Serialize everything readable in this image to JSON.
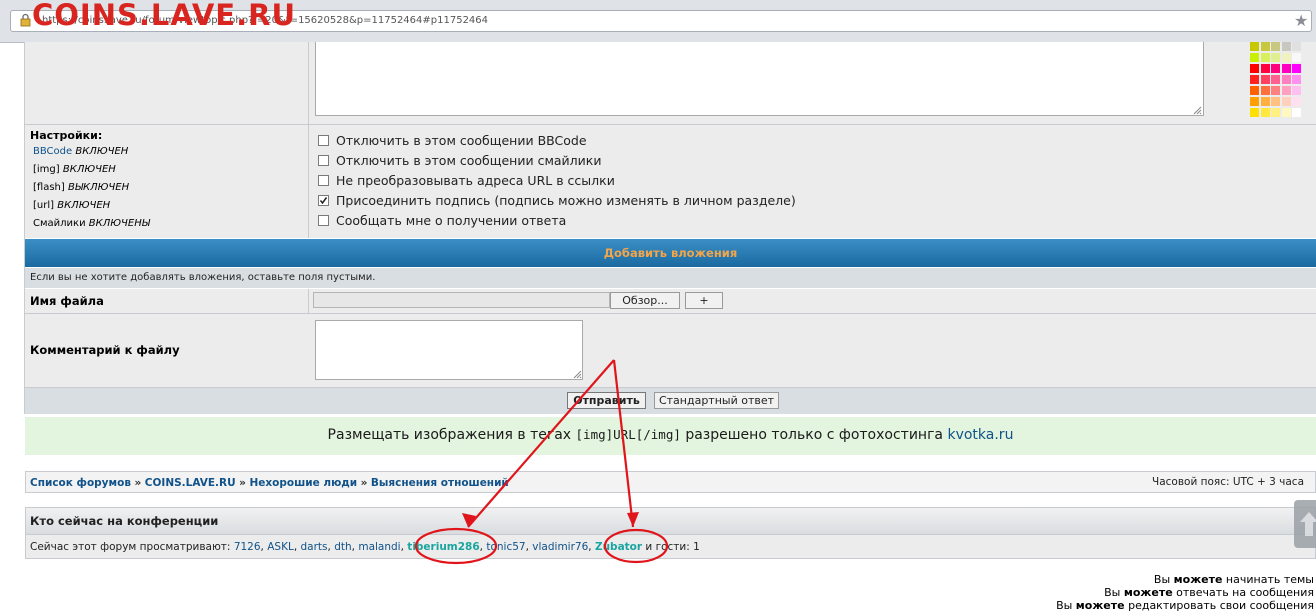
{
  "watermark": "COINS.LAVE.RU",
  "browser": {
    "url": "https://coins.lave.ru/forum/viewtopic.php?f=20&t=15620528&p=11752464#p11752464",
    "url_visible": "https://coins.lave.ru/forum/viewtopic.php?f=20&t=15620528&p=11752464#p11752464"
  },
  "settings": {
    "title": "Настройки:",
    "lines": [
      {
        "name": "BBCode",
        "state": "ВКЛЮЧЕН"
      },
      {
        "name": "[img]",
        "state": "ВКЛЮЧЕН"
      },
      {
        "name": "[flash]",
        "state": "ВЫКЛЮЧЕН"
      },
      {
        "name": "[url]",
        "state": "ВКЛЮЧЕН"
      },
      {
        "name": "Смайлики",
        "state": "ВКЛЮЧЕНЫ"
      }
    ],
    "options": [
      {
        "label": "Отключить в этом сообщении BBCode",
        "checked": false
      },
      {
        "label": "Отключить в этом сообщении смайлики",
        "checked": false
      },
      {
        "label": "Не преобразовывать адреса URL в ссылки",
        "checked": false
      },
      {
        "label": "Присоединить подпись (подпись можно изменять в личном разделе)",
        "checked": true
      },
      {
        "label": "Сообщать мне о получении ответа",
        "checked": false
      }
    ]
  },
  "attachments": {
    "header": "Добавить вложения",
    "note": "Если вы не хотите добавлять вложения, оставьте поля пустыми.",
    "filename_label": "Имя файла",
    "browse_button": "Обзор...",
    "add_button": "+",
    "comment_label": "Комментарий к файлу"
  },
  "buttons": {
    "submit": "Отправить",
    "standard_reply": "Стандартный ответ"
  },
  "notice": {
    "before": "Размещать изображения в тегах ",
    "tag": "[img]URL[/img]",
    "after": " разрешено только с фотохостинга ",
    "link": "kvotka.ru"
  },
  "breadcrumb": {
    "items": [
      "Список форумов",
      "COINS.LAVE.RU",
      "Нехорошие люди",
      "Выяснения отношений"
    ],
    "separator": "»",
    "timezone": "Часовой пояс: UTC + 3 часа"
  },
  "online": {
    "title": "Кто сейчас на конференции",
    "prefix": "Сейчас этот форум просматривают:",
    "users": [
      "7126",
      "ASKL",
      "darts",
      "dth",
      "malandi",
      "tiberium286",
      "tonic57",
      "vladimir76",
      "Zubator"
    ],
    "highlighted": [
      "tiberium286",
      "Zubator"
    ],
    "suffix": "и гости: 1"
  },
  "permissions": {
    "line1_pre": "Вы ",
    "line1_bold": "можете",
    "line1_post": " начинать темы",
    "line2_pre": "Вы ",
    "line2_bold": "можете",
    "line2_post": " отвечать на сообщения",
    "line3_pre": "Вы ",
    "line3_bold": "можете",
    "line3_post": " редактировать свои сообщения"
  },
  "colors": {
    "annotation_red": "#e0151b",
    "link_blue": "#105289",
    "header_orange": "#f2a54a",
    "header_blue": "#1a6aa0",
    "notice_green": "#e3f5df"
  }
}
